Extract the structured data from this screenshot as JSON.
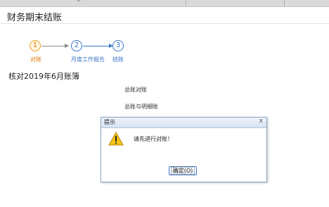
{
  "window": {
    "title": "财务期末结账"
  },
  "steps": [
    {
      "number": "1",
      "label": "对账",
      "state": "active"
    },
    {
      "number": "2",
      "label": "月度工作报告",
      "state": "todo"
    },
    {
      "number": "3",
      "label": "结账",
      "state": "todo"
    }
  ],
  "main": {
    "heading": "核对2019年6月账簿",
    "items": [
      "总账对账",
      "总账与明细账"
    ]
  },
  "dialog": {
    "title": "提示",
    "close_glyph": "x",
    "message": "请先进行对账！",
    "ok_button": "确定(O)"
  },
  "colors": {
    "active_step": "#f0a020",
    "todo_step": "#3a77c9"
  }
}
